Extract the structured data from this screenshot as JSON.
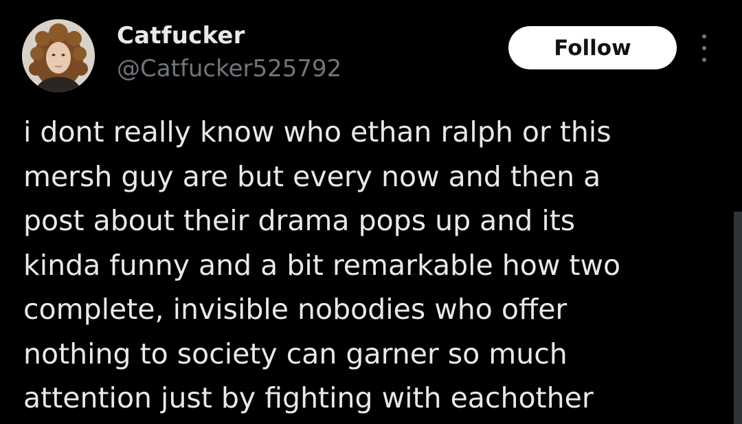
{
  "author": {
    "display_name": "Catfucker",
    "handle": "@Catfucker525792"
  },
  "actions": {
    "follow_label": "Follow",
    "more_icon": "more-options-icon"
  },
  "tweet": {
    "text": "i dont really know who ethan ralph or this\nmersh guy are but every now and then a\npost about their drama pops up and its\nkinda funny and a bit remarkable how two\ncomplete, invisible nobodies who offer\nnothing to society can garner so much\nattention just by fighting with eachother"
  },
  "colors": {
    "background": "#000000",
    "primary_text": "#e7e9ea",
    "secondary_text": "#71767b",
    "follow_button_bg": "#ffffff",
    "follow_button_text": "#0f1419"
  }
}
